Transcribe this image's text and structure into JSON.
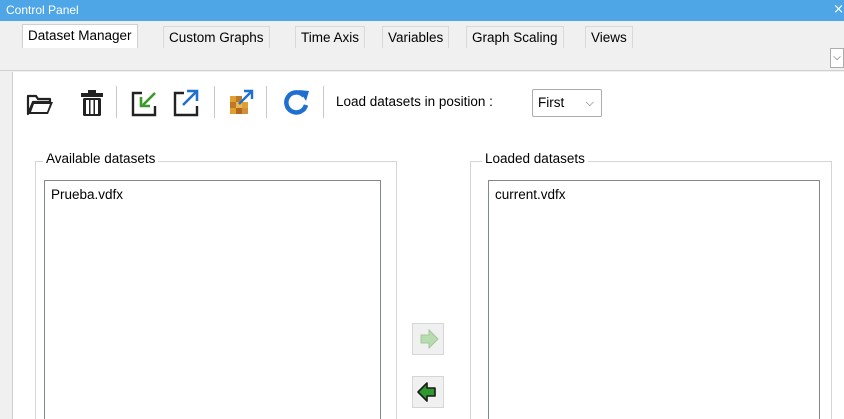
{
  "window": {
    "title": "Control Panel",
    "close_glyph": "×"
  },
  "tabs": [
    {
      "label": "Dataset Manager",
      "active": true
    },
    {
      "label": "Custom Graphs",
      "active": false
    },
    {
      "label": "Time Axis",
      "active": false
    },
    {
      "label": "Variables",
      "active": false
    },
    {
      "label": "Graph Scaling",
      "active": false
    },
    {
      "label": "Views",
      "active": false
    }
  ],
  "toolbar": {
    "buttons": [
      {
        "icon": "open-folder-icon"
      },
      {
        "icon": "trash-icon"
      },
      {
        "icon": "import-icon"
      },
      {
        "icon": "export-icon"
      },
      {
        "icon": "merge-datasets-icon"
      },
      {
        "icon": "refresh-icon"
      }
    ],
    "load_position_label": "Load datasets in position :",
    "load_position_value": "First"
  },
  "available": {
    "label": "Available datasets",
    "items": [
      "Prueba.vdfx"
    ]
  },
  "loaded": {
    "label": "Loaded datasets",
    "items": [
      "current.vdfx"
    ]
  },
  "colors": {
    "titlebar": "#4ea6e6",
    "arrow_enabled": "#2e9a2e",
    "arrow_disabled": "#b6dcb0",
    "refresh_blue": "#1f6fd1"
  }
}
